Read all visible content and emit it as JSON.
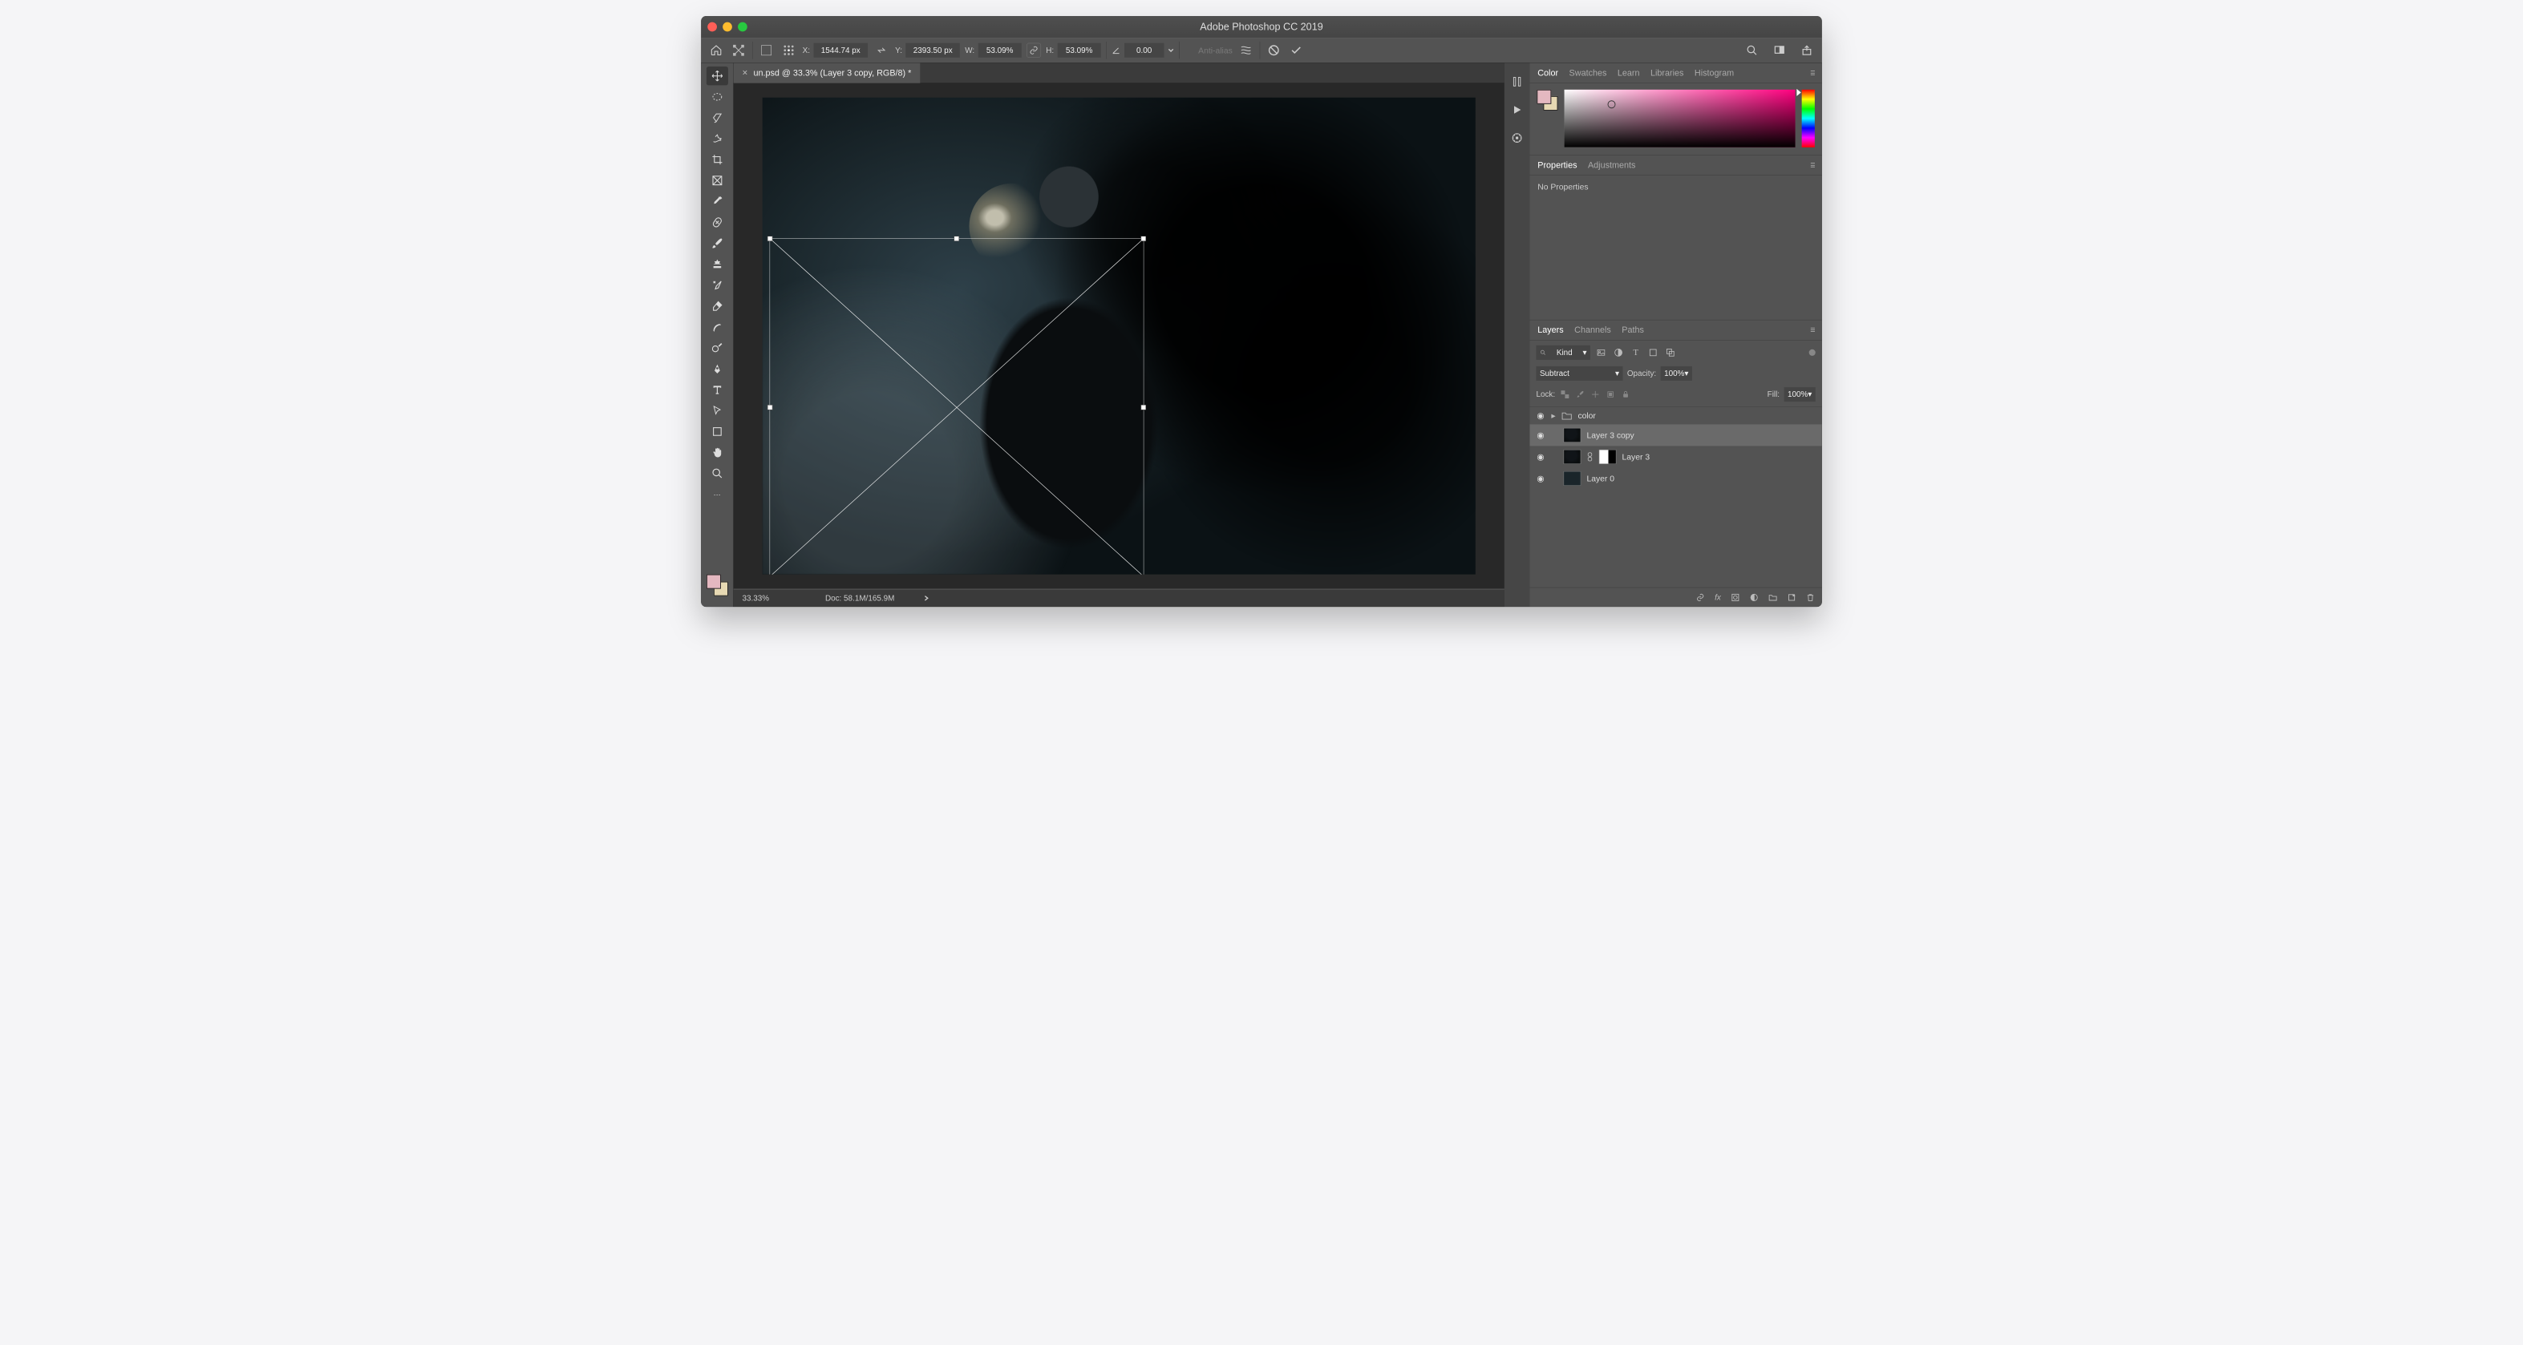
{
  "app_title": "Adobe Photoshop CC 2019",
  "options": {
    "x_label": "X:",
    "x_value": "1544.74 px",
    "y_label": "Y:",
    "y_value": "2393.50 px",
    "w_label": "W:",
    "w_value": "53.09%",
    "h_label": "H:",
    "h_value": "53.09%",
    "angle_value": "0.00",
    "anti_alias": "Anti-alias"
  },
  "document": {
    "tab_title": "un.psd @ 33.3% (Layer 3 copy, RGB/8) *"
  },
  "status": {
    "zoom": "33.33%",
    "doc": "Doc: 58.1M/165.9M"
  },
  "panel_tabs_color": {
    "color": "Color",
    "swatches": "Swatches",
    "learn": "Learn",
    "libraries": "Libraries",
    "histogram": "Histogram"
  },
  "panel_tabs_props": {
    "properties": "Properties",
    "adjustments": "Adjustments"
  },
  "properties": {
    "none": "No Properties"
  },
  "panel_tabs_layers": {
    "layers": "Layers",
    "channels": "Channels",
    "paths": "Paths"
  },
  "layers_panel": {
    "kind_placeholder": "Kind",
    "blend_mode": "Subtract",
    "opacity_label": "Opacity:",
    "opacity_value": "100%",
    "lock_label": "Lock:",
    "fill_label": "Fill:",
    "fill_value": "100%",
    "layers": [
      {
        "name": "color"
      },
      {
        "name": "Layer 3 copy"
      },
      {
        "name": "Layer 3"
      },
      {
        "name": "Layer 0"
      }
    ]
  }
}
